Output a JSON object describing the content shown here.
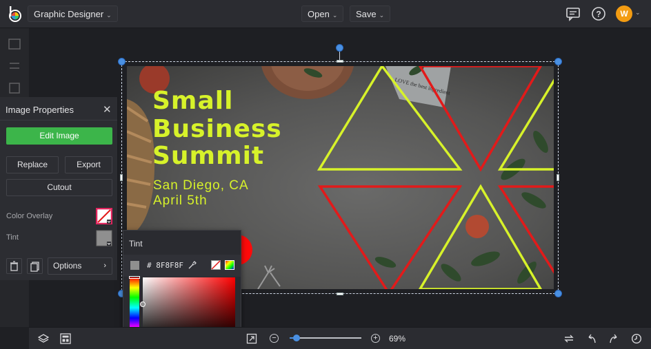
{
  "app": {
    "workspace_label": "Graphic Designer"
  },
  "topbar": {
    "open_label": "Open",
    "save_label": "Save",
    "avatar_initial": "W",
    "icons": [
      "logo-icon",
      "comment-icon",
      "help-icon",
      "avatar"
    ]
  },
  "canvas": {
    "title_lines": [
      "Small",
      "Business",
      "Summit"
    ],
    "subtitle_lines": [
      "San Diego, CA",
      "April 5th"
    ],
    "decor_note_text": "LOVE the best ingredient",
    "colors": {
      "text_accent": "#d7f22a",
      "triangle_yellow": "#d7f22a",
      "triangle_red": "#e21a1a",
      "selection": "#4a90e2"
    }
  },
  "image_properties": {
    "title": "Image Properties",
    "edit_image_label": "Edit Image",
    "replace_label": "Replace",
    "export_label": "Export",
    "cutout_label": "Cutout",
    "color_overlay_label": "Color Overlay",
    "tint_label": "Tint",
    "options_label": "Options",
    "colors": {
      "edit_button": "#3cb54a",
      "overlay_swatch_border": "#e0245e",
      "tint_swatch": "#8f8f8f"
    }
  },
  "tint_picker": {
    "title": "Tint",
    "hex_value": "# 8F8F8F",
    "color": "#8f8f8f"
  },
  "bottombar": {
    "zoom_value": "69%",
    "zoom_fraction": 0.69,
    "icons": [
      "layers-icon",
      "template-icon",
      "fit-screen-icon",
      "zoom-out-icon",
      "zoom-in-icon",
      "flip-icon",
      "undo-icon",
      "redo-icon",
      "history-icon"
    ]
  }
}
